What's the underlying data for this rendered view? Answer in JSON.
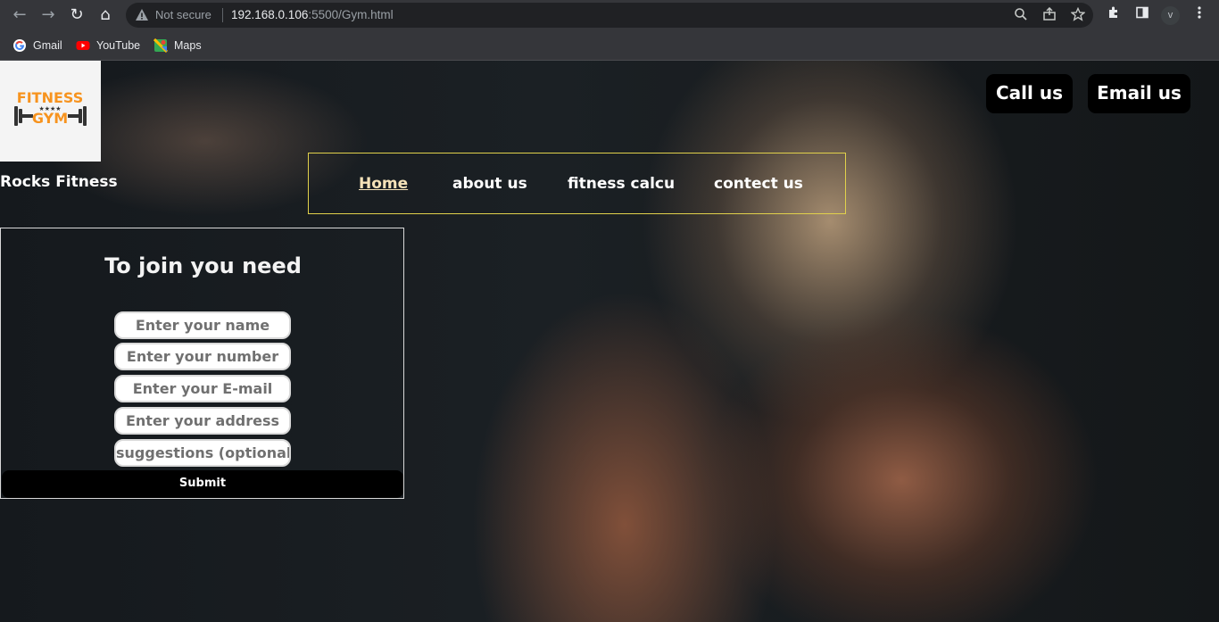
{
  "browser": {
    "nav_back": "←",
    "nav_forward": "→",
    "reload": "↻",
    "home": "⌂",
    "security_label": "Not secure",
    "url_host": "192.168.0.106",
    "url_rest": ":5500/Gym.html",
    "profile_initial": "v",
    "icons": [
      "zoom-icon",
      "share-icon",
      "star-icon",
      "extensions-icon",
      "sidebar-icon",
      "menu-icon"
    ]
  },
  "bookmarks": [
    {
      "label": "Gmail",
      "icon": "google-icon"
    },
    {
      "label": "YouTube",
      "icon": "youtube-icon"
    },
    {
      "label": "Maps",
      "icon": "maps-icon"
    }
  ],
  "site": {
    "logo_word1": "FITNESS",
    "logo_word2": "GYM",
    "name": "Rocks Fitness",
    "accent_color": "#f7931e",
    "nav_border_color": "#e1d14b"
  },
  "nav": {
    "home": "Home",
    "about": "about us",
    "calc": "fitness calcu",
    "contact": "contect us"
  },
  "header_buttons": {
    "call": "Call us",
    "email": "Email us"
  },
  "form": {
    "title": "To join you need",
    "name_placeholder": "Enter your name",
    "number_placeholder": "Enter your number",
    "email_placeholder": "Enter your E-mail",
    "address_placeholder": "Enter your address",
    "suggestions_placeholder": "suggestions (optional)",
    "submit_label": "Submit"
  }
}
